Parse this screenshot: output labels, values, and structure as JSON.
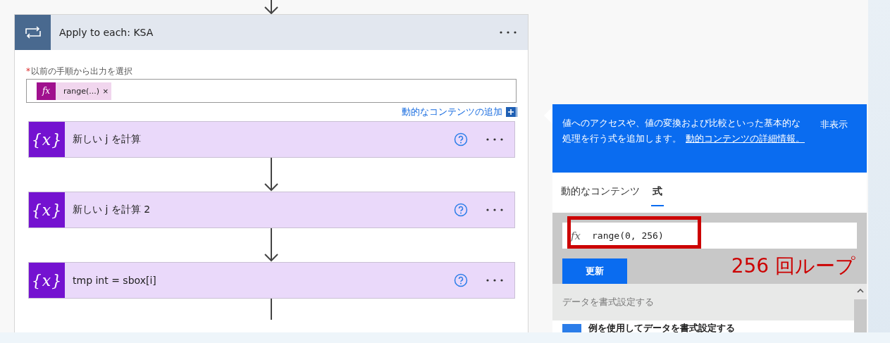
{
  "loop": {
    "title": "Apply to each: KSA",
    "field_label": "以前の手順から出力を選択",
    "required_mark": "*",
    "token": {
      "icon": "fx",
      "label": "range(...)",
      "remove": "×"
    },
    "add_link": "動的なコンテンツの追加",
    "actions": [
      {
        "icon": "{x}",
        "title": "新しい j を計算"
      },
      {
        "icon": "{x}",
        "title": "新しい j を計算 2"
      },
      {
        "icon": "{x}",
        "title": "tmp int = sbox[i]"
      }
    ]
  },
  "panel": {
    "info": "値へのアクセスや、値の変換および比較といった基本的な処理を行う式を追加します。",
    "info_link": "動的コンテンツの詳細情報。",
    "hide": "非表示",
    "tabs": [
      {
        "label": "動的なコンテンツ",
        "selected": false
      },
      {
        "label": "式",
        "selected": true
      }
    ],
    "expression_icon": "fx",
    "expression": "range(0, 256)",
    "update_button": "更新",
    "annotation": "256 回ループ",
    "section": "データを書式設定する",
    "item": "例を使用してデータを書式設定する"
  }
}
